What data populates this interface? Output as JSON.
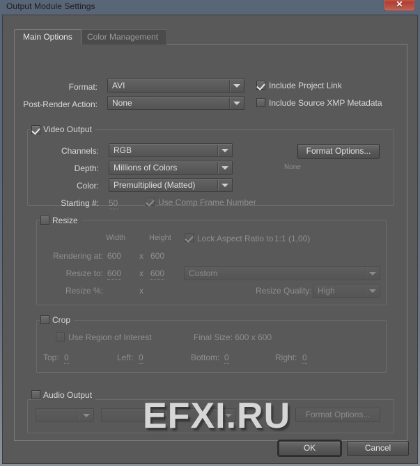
{
  "window": {
    "title": "Output Module Settings",
    "close_label": "✕"
  },
  "tabs": [
    {
      "label": "Main Options",
      "active": true
    },
    {
      "label": "Color Management",
      "active": false
    }
  ],
  "main_options": {
    "format_label": "Format:",
    "format_value": "AVI",
    "post_render_label": "Post-Render Action:",
    "post_render_value": "None",
    "include_project_link_label": "Include Project Link",
    "include_project_link_checked": true,
    "include_xmp_label": "Include Source XMP Metadata",
    "include_xmp_checked": false
  },
  "video_output": {
    "group_label": "Video Output",
    "checked": true,
    "channels_label": "Channels:",
    "channels_value": "RGB",
    "depth_label": "Depth:",
    "depth_value": "Millions of Colors",
    "color_label": "Color:",
    "color_value": "Premultiplied (Matted)",
    "starting_label": "Starting #:",
    "starting_value": "50",
    "use_comp_frame_label": "Use Comp Frame Number",
    "use_comp_frame_checked": true,
    "format_options_label": "Format Options...",
    "format_options_status": "None"
  },
  "resize": {
    "group_label": "Resize",
    "checked": false,
    "width_header": "Width",
    "height_header": "Height",
    "lock_aspect_label": "Lock Aspect Ratio to",
    "lock_aspect_value": "1:1 (1,00)",
    "lock_aspect_checked": true,
    "rendering_at_label": "Rendering at:",
    "rendering_width": "600",
    "rendering_x": "x",
    "rendering_height": "600",
    "resize_to_label": "Resize to:",
    "resize_to_width": "600",
    "resize_to_x": "x",
    "resize_to_height": "600",
    "preset_value": "Custom",
    "resize_pct_label": "Resize %:",
    "resize_pct_x": "x",
    "resize_quality_label": "Resize Quality:",
    "resize_quality_value": "High"
  },
  "crop": {
    "group_label": "Crop",
    "checked": false,
    "use_roi_label": "Use Region of Interest",
    "use_roi_checked": false,
    "final_size_label": "Final Size: 600 x 600",
    "top_label": "Top:",
    "top_value": "0",
    "left_label": "Left:",
    "left_value": "0",
    "bottom_label": "Bottom:",
    "bottom_value": "0",
    "right_label": "Right:",
    "right_value": "0"
  },
  "audio_output": {
    "group_label": "Audio Output",
    "checked": false,
    "rate_value": "",
    "depth_value": "",
    "channels_value": "",
    "format_options_label": "Format Options..."
  },
  "footer": {
    "ok_label": "OK",
    "cancel_label": "Cancel"
  },
  "watermark": {
    "text": "EFXI.RU"
  }
}
